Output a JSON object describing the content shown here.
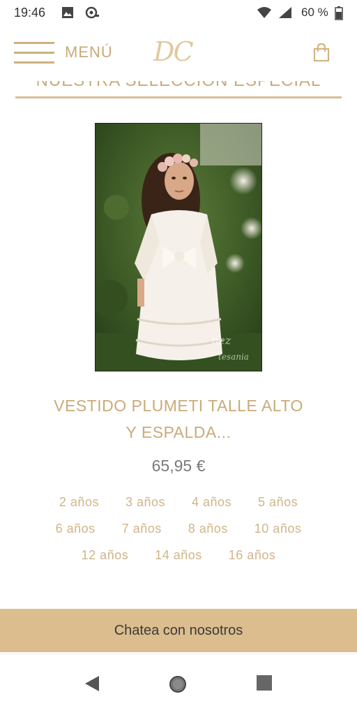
{
  "status_bar": {
    "time": "19:46",
    "battery": "60 %",
    "icons": [
      "image-icon",
      "gamepad-icon",
      "wifi-icon",
      "signal-icon",
      "battery-icon"
    ]
  },
  "header": {
    "menu_label": "MENÚ",
    "logo": "DC",
    "icons": [
      "hamburger-icon",
      "shopping-bag-icon"
    ]
  },
  "section": {
    "title": "NUESTRA SELECCIÓN ESPECIAL"
  },
  "product": {
    "title_line1": "VESTIDO PLUMETI TALLE ALTO",
    "title_line2": "Y ESPALDA...",
    "price": "65,95 €",
    "size_rows": [
      [
        "2 años",
        "3 años",
        "4 años",
        "5 años"
      ],
      [
        "6 años",
        "7 años",
        "8 años",
        "10 años"
      ],
      [
        "12 años",
        "14 años",
        "16 años"
      ]
    ]
  },
  "chat": {
    "label": "Chatea con nosotros"
  },
  "nav": {
    "icons": [
      "back-icon",
      "home-icon",
      "recents-icon"
    ]
  },
  "colors": {
    "accent": "#c9ab79",
    "chat_bar": "#dcbd8d",
    "price": "#7a7a7a"
  }
}
